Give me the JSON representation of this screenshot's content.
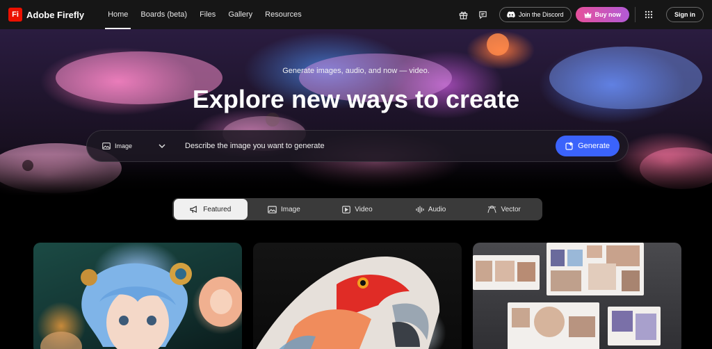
{
  "brand": {
    "logo_text": "Fi",
    "name": "Adobe Firefly",
    "color": "#eb1000"
  },
  "nav": {
    "items": [
      {
        "label": "Home",
        "active": true
      },
      {
        "label": "Boards (beta)",
        "active": false
      },
      {
        "label": "Files",
        "active": false
      },
      {
        "label": "Gallery",
        "active": false
      },
      {
        "label": "Resources",
        "active": false
      }
    ]
  },
  "header_actions": {
    "gift_icon": "gift-icon",
    "feedback_icon": "chat-icon",
    "discord_label": "Join the Discord",
    "buy_label": "Buy now",
    "apps_icon": "app-grid-icon",
    "signin_label": "Sign in"
  },
  "hero": {
    "subtitle": "Generate images, audio, and now — video.",
    "title": "Explore new ways to create",
    "prompt": {
      "type_label": "Image",
      "placeholder": "Describe the image you want to generate",
      "generate_label": "Generate",
      "generate_color": "#3b63fb"
    }
  },
  "tabs": [
    {
      "label": "Featured",
      "icon": "megaphone-icon",
      "active": true
    },
    {
      "label": "Image",
      "icon": "image-icon",
      "active": false
    },
    {
      "label": "Video",
      "icon": "video-icon",
      "active": false
    },
    {
      "label": "Audio",
      "icon": "audio-wave-icon",
      "active": false
    },
    {
      "label": "Vector",
      "icon": "vector-pen-icon",
      "active": false
    }
  ],
  "cards": [
    {
      "name": "anime-portrait"
    },
    {
      "name": "parrot"
    },
    {
      "name": "moodboard"
    }
  ]
}
